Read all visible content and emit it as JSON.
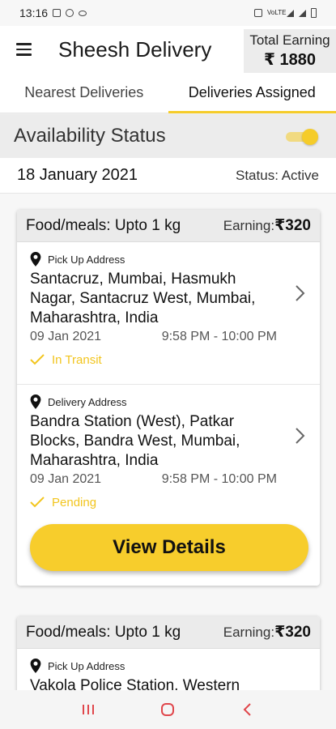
{
  "status_bar": {
    "time": "13:16",
    "net_label": "VoLTE"
  },
  "app": {
    "title": "Sheesh Delivery",
    "earning_label": "Total Earning",
    "earning_value": "₹ 1880"
  },
  "tabs": [
    {
      "label": "Nearest Deliveries",
      "active": false
    },
    {
      "label": "Deliveries Assigned",
      "active": true
    }
  ],
  "availability": {
    "label": "Availability Status",
    "enabled": true
  },
  "date_row": {
    "date": "18 January 2021",
    "status": "Status: Active"
  },
  "colors": {
    "accent": "#f5cc2a",
    "header_gray": "#ebebeb"
  },
  "cards": [
    {
      "category": "Food/meals: Upto 1 kg",
      "earning_label": "Earning:",
      "earning_value": "₹320",
      "pickup": {
        "label": "Pick Up Address",
        "address": "Santacruz, Mumbai, Hasmukh Nagar, Santacruz West, Mumbai, Maharashtra, India",
        "date": "09 Jan 2021",
        "time": "9:58 PM - 10:00 PM",
        "status": "In Transit"
      },
      "delivery": {
        "label": "Delivery Address",
        "address": "Bandra Station (West), Patkar Blocks, Bandra West, Mumbai, Maharashtra, India",
        "date": "09 Jan 2021",
        "time": "9:58 PM - 10:00 PM",
        "status": "Pending"
      },
      "button_label": "View Details"
    },
    {
      "category": "Food/meals: Upto 1 kg",
      "earning_label": "Earning:",
      "earning_value": "₹320",
      "pickup": {
        "label": "Pick Up Address",
        "address": "Vakola Police Station, Western"
      }
    }
  ],
  "nav_icons": [
    "recent-apps-icon",
    "home-icon",
    "back-icon"
  ]
}
